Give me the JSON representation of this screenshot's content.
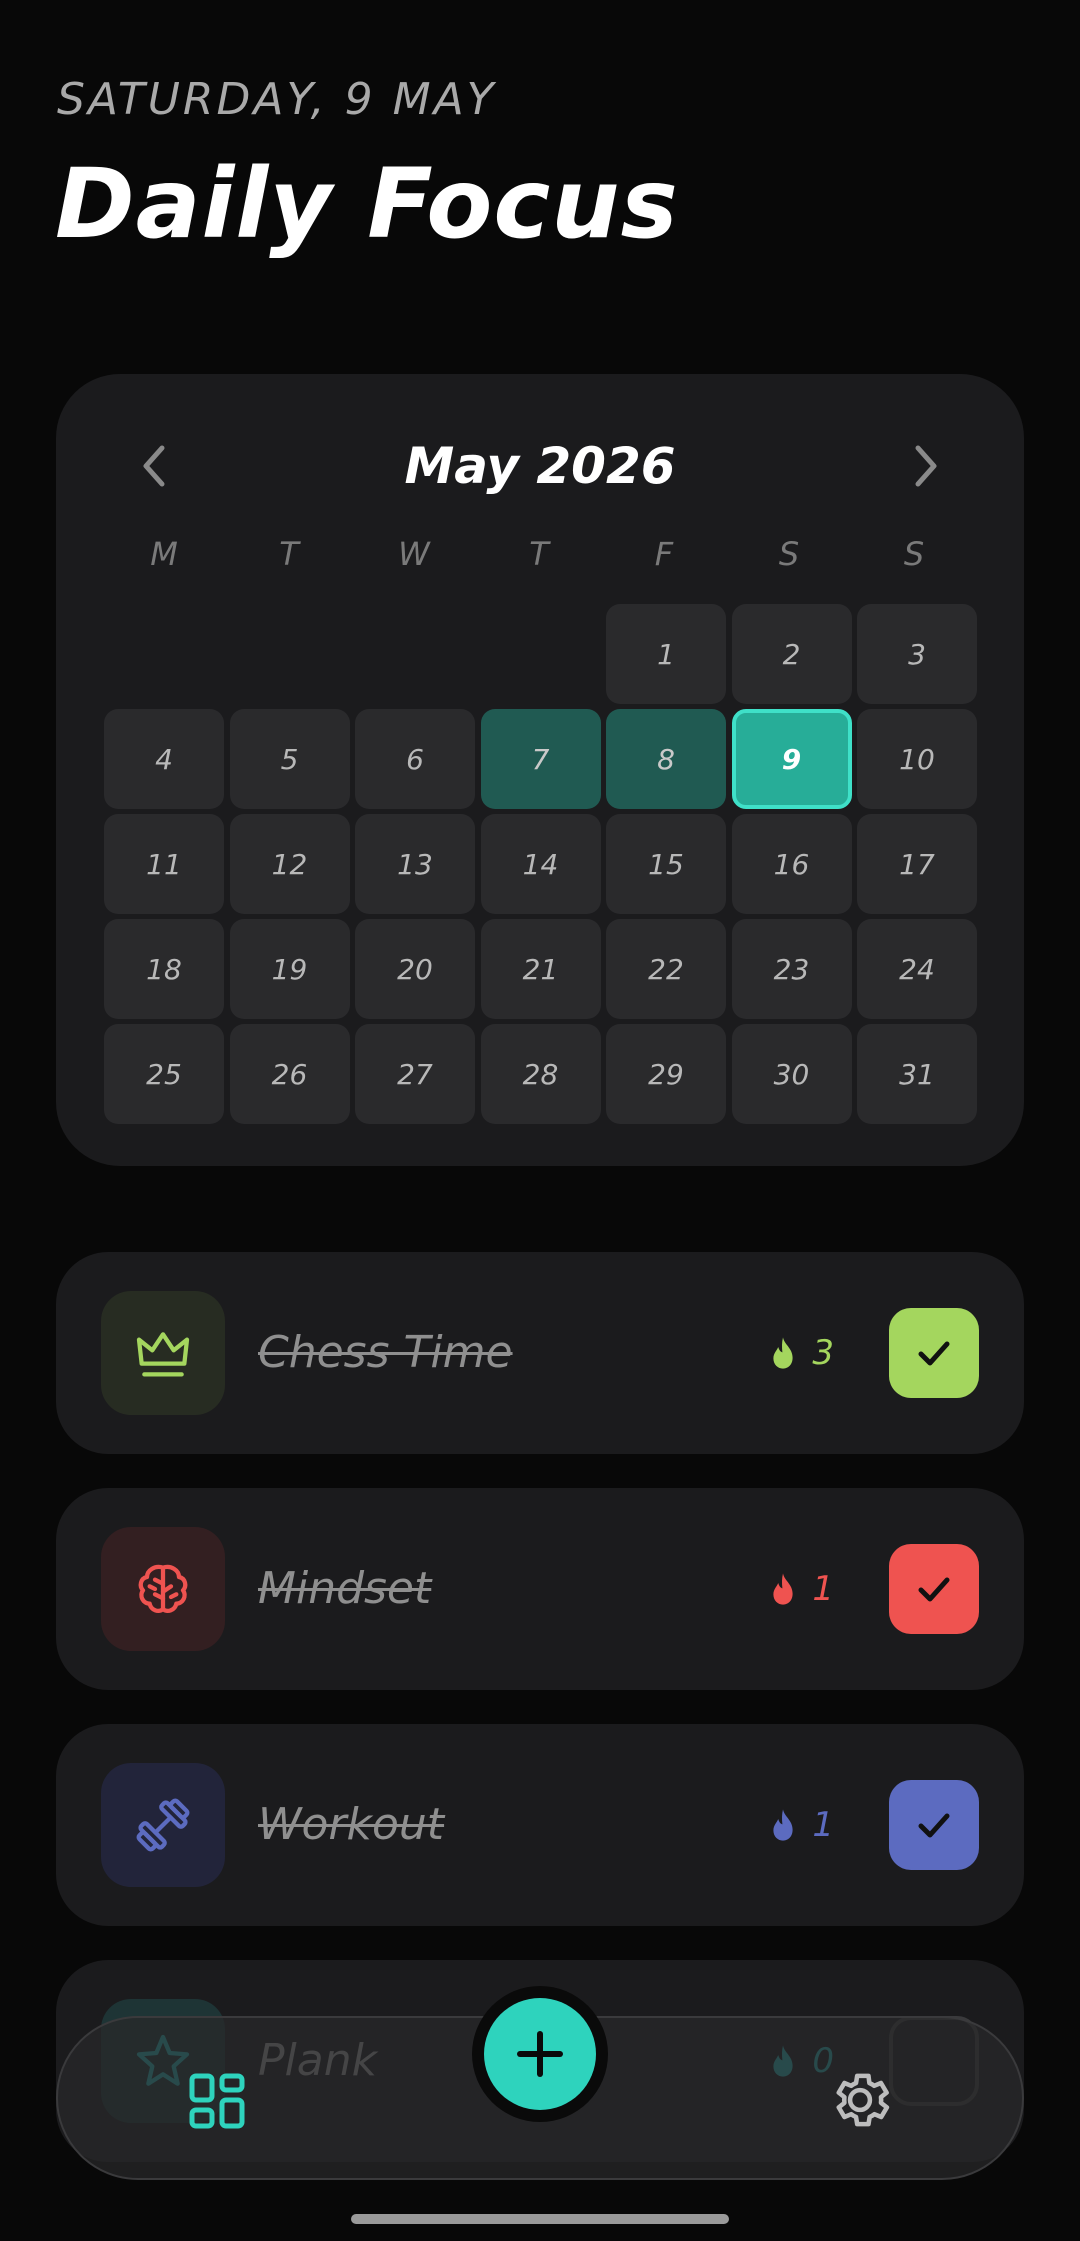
{
  "header": {
    "date": "SATURDAY, 9 MAY",
    "title": "Daily Focus"
  },
  "calendar": {
    "month_label": "May 2026",
    "weekdays": [
      "M",
      "T",
      "W",
      "T",
      "F",
      "S",
      "S"
    ],
    "leading_blanks": 4,
    "days": [
      "1",
      "2",
      "3",
      "4",
      "5",
      "6",
      "7",
      "8",
      "9",
      "10",
      "11",
      "12",
      "13",
      "14",
      "15",
      "16",
      "17",
      "18",
      "19",
      "20",
      "21",
      "22",
      "23",
      "24",
      "25",
      "26",
      "27",
      "28",
      "29",
      "30",
      "31"
    ],
    "completed_days": [
      "7",
      "8"
    ],
    "today": "9",
    "colors": {
      "completed": "#205a52",
      "today": "#27ad98",
      "today_border": "#3fe0c8"
    }
  },
  "habits": [
    {
      "name": "Chess Time",
      "streak": "3",
      "icon": "crown-icon",
      "color": "#a4d65e",
      "icon_bg": "#272c22",
      "checked": true
    },
    {
      "name": "Mindset",
      "streak": "1",
      "icon": "brain-icon",
      "color": "#ef5350",
      "icon_bg": "#331f21",
      "checked": true
    },
    {
      "name": "Workout",
      "streak": "1",
      "icon": "dumbbell-icon",
      "color": "#5c6bc0",
      "icon_bg": "#22243a",
      "checked": true
    },
    {
      "name": "Plank",
      "streak": "0",
      "icon": "star-icon",
      "color": "#2aa1a1",
      "icon_bg": "#1e3435",
      "checked": false
    }
  ],
  "nav": {
    "dashboard_icon": "dashboard-icon",
    "add_icon": "plus-icon",
    "settings_icon": "gear-icon",
    "accent": "#2ed3bd"
  }
}
